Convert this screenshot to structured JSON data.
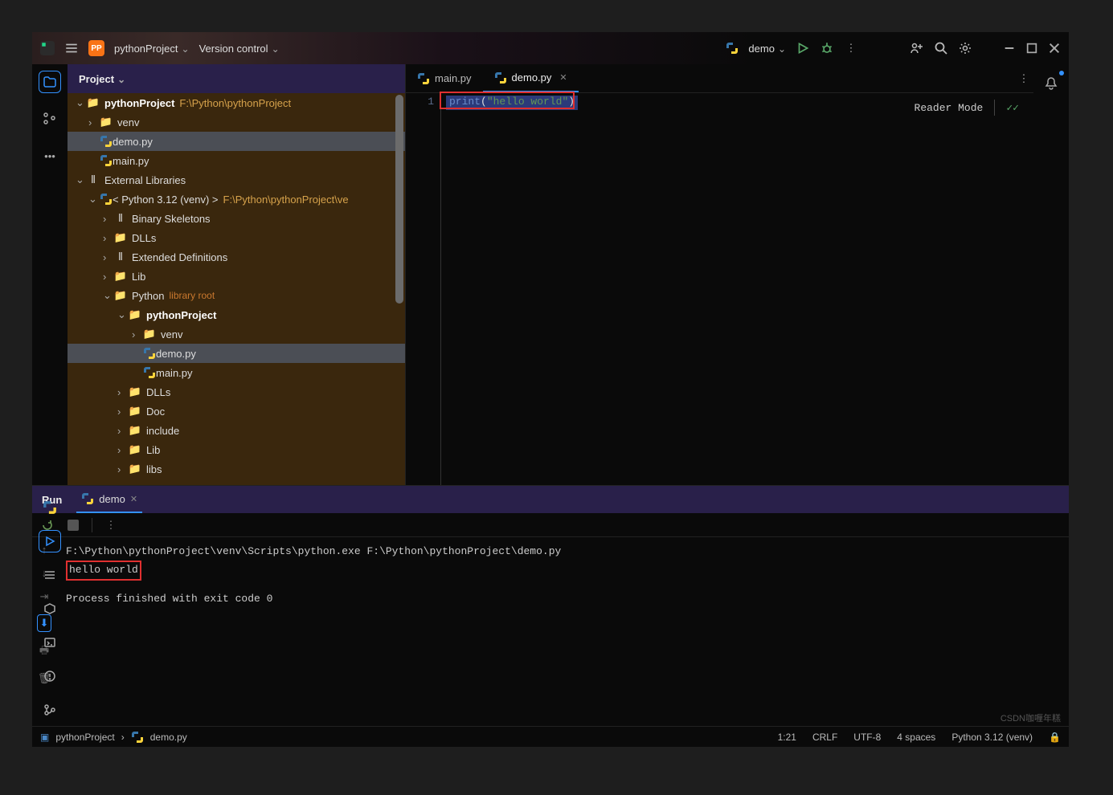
{
  "titlebar": {
    "project_badge": "PP",
    "project_name": "pythonProject",
    "vcs": "Version control",
    "run_config": "demo"
  },
  "project_panel": {
    "title": "Project"
  },
  "tree": {
    "root": {
      "name": "pythonProject",
      "path": "F:\\Python\\pythonProject"
    },
    "venv": "venv",
    "demo": "demo.py",
    "main": "main.py",
    "ext_lib": "External Libraries",
    "py312": "< Python 3.12 (venv) >",
    "py312_path": "F:\\Python\\pythonProject\\ve",
    "bskel": "Binary Skeletons",
    "dlls": "DLLs",
    "extdef": "Extended Definitions",
    "lib": "Lib",
    "python": "Python",
    "libroot": "library root",
    "pyproj": "pythonProject",
    "venv2": "venv",
    "demo2": "demo.py",
    "main2": "main.py",
    "dlls2": "DLLs",
    "doc": "Doc",
    "include": "include",
    "lib2": "Lib",
    "libs": "libs"
  },
  "tabs": {
    "main": "main.py",
    "demo": "demo.py"
  },
  "editor": {
    "line1_num": "1",
    "code_print": "print",
    "code_lpar": "(",
    "code_str": "\"hello world\"",
    "code_rpar": ")",
    "reader_mode": "Reader Mode"
  },
  "run": {
    "title": "Run",
    "tab": "demo",
    "cmd": "F:\\Python\\pythonProject\\venv\\Scripts\\python.exe F:\\Python\\pythonProject\\demo.py",
    "out": "hello world",
    "exit": "Process finished with exit code 0"
  },
  "status": {
    "breadcrumb_proj": "pythonProject",
    "breadcrumb_file": "demo.py",
    "pos": "1:21",
    "eol": "CRLF",
    "enc": "UTF-8",
    "indent": "4 spaces",
    "interp": "Python 3.12 (venv)"
  },
  "watermark": "CSDN咖喱年糕"
}
